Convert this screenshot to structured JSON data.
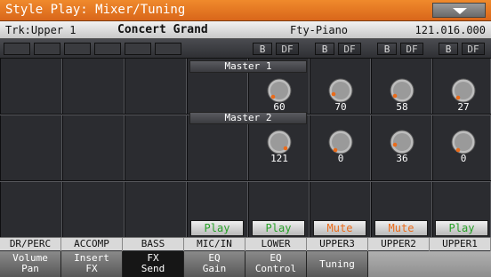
{
  "title": "Style Play: Mixer/Tuning",
  "info": {
    "track": "Trk:Upper 1",
    "sound": "Concert Grand",
    "bank": "Fty-Piano",
    "program_number": "121.016.000"
  },
  "top_buttons": {
    "b": "B",
    "df": "DF"
  },
  "masters": [
    "Master 1",
    "Master 2"
  ],
  "send1_values": [
    "60",
    "70",
    "58",
    "27"
  ],
  "send2_values": [
    "121",
    "0",
    "36",
    "0"
  ],
  "play_buttons": [
    "Play",
    "Play",
    "Mute",
    "Mute",
    "Play"
  ],
  "channel_labels": [
    "DR/PERC",
    "ACCOMP",
    "BASS",
    "MIC/IN",
    "LOWER",
    "UPPER3",
    "UPPER2",
    "UPPER1"
  ],
  "tabs": [
    {
      "l1": "Volume",
      "l2": "Pan"
    },
    {
      "l1": "Insert",
      "l2": "FX"
    },
    {
      "l1": "FX",
      "l2": "Send"
    },
    {
      "l1": "EQ",
      "l2": "Gain"
    },
    {
      "l1": "EQ",
      "l2": "Control"
    },
    {
      "l1": "Tuning",
      "l2": ""
    }
  ],
  "colors": {
    "accent": "#ea6b1a",
    "play": "#28a028",
    "mute": "#ea6b1a"
  }
}
